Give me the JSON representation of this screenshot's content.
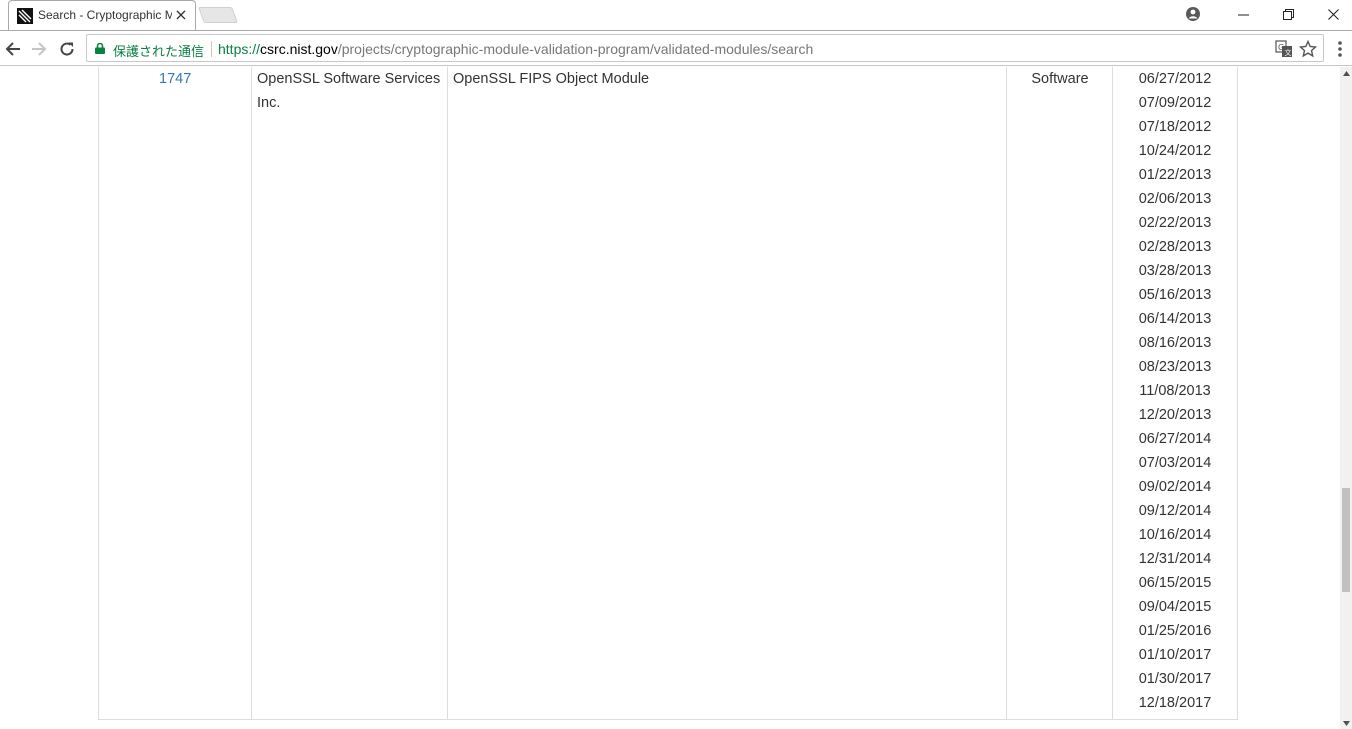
{
  "tab": {
    "title": "Search - Cryptographic Module Validation Program",
    "close_icon": "close-icon",
    "favicon": "nist-favicon-icon"
  },
  "window": {
    "profile_icon": "profile-icon",
    "minimize_icon": "minimize-icon",
    "restore_icon": "restore-icon",
    "close_icon": "close-icon"
  },
  "toolbar": {
    "secure_label": "保護された通信",
    "url_scheme": "https://",
    "url_host": "csrc.nist.gov",
    "url_path": "/projects/cryptographic-module-validation-program/validated-modules/search",
    "translate_icon": "translate-icon",
    "bookmark_icon": "star-icon",
    "menu_icon": "kebab-menu-icon"
  },
  "colors": {
    "secure_green": "#0b8043",
    "link_blue": "#337ab7",
    "table_border": "#dddddd",
    "text": "#333333"
  },
  "row": {
    "certificate": "1747",
    "vendor": "OpenSSL Software Services Inc.",
    "module_name": "OpenSSL FIPS Object Module",
    "module_type": "Software",
    "validation_dates": [
      "06/27/2012",
      "07/09/2012",
      "07/18/2012",
      "10/24/2012",
      "01/22/2013",
      "02/06/2013",
      "02/22/2013",
      "02/28/2013",
      "03/28/2013",
      "05/16/2013",
      "06/14/2013",
      "08/16/2013",
      "08/23/2013",
      "11/08/2013",
      "12/20/2013",
      "06/27/2014",
      "07/03/2014",
      "09/02/2014",
      "09/12/2014",
      "10/16/2014",
      "12/31/2014",
      "06/15/2015",
      "09/04/2015",
      "01/25/2016",
      "01/10/2017",
      "01/30/2017",
      "12/18/2017"
    ]
  }
}
